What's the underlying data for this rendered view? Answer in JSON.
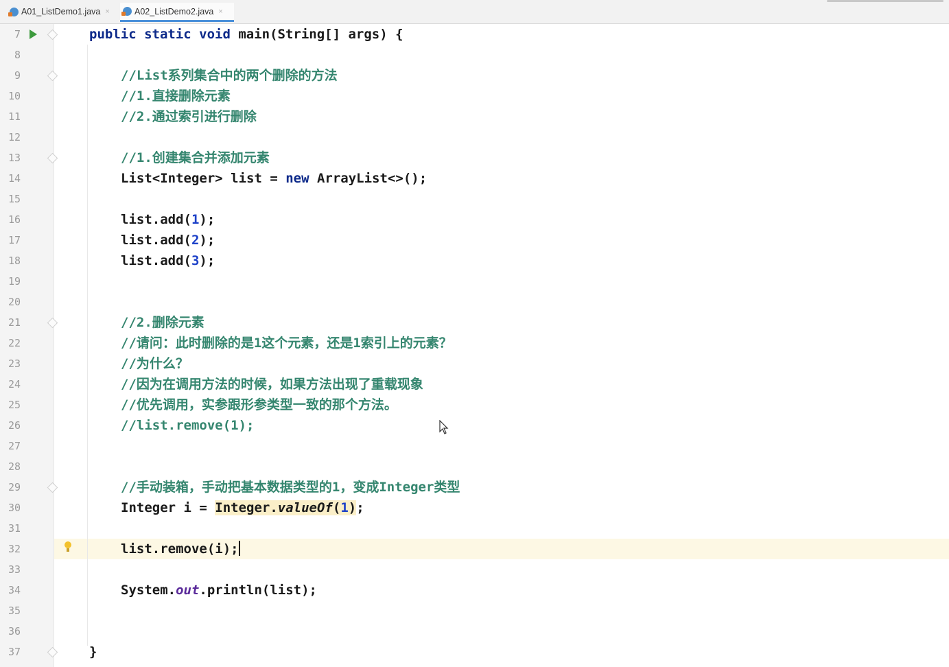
{
  "tabs": [
    {
      "label": "A01_ListDemo1.java",
      "active": false,
      "close_glyph": "×"
    },
    {
      "label": "A02_ListDemo2.java",
      "active": true,
      "close_glyph": "×"
    }
  ],
  "code": {
    "line7": {
      "n": "7",
      "kw1": "public static void",
      "rest": " main(String[] args) {"
    },
    "line8": {
      "n": "8"
    },
    "line9": {
      "n": "9",
      "comment": "//List系列集合中的两个删除的方法"
    },
    "line10": {
      "n": "10",
      "comment": "//1.直接删除元素"
    },
    "line11": {
      "n": "11",
      "comment": "//2.通过索引进行删除"
    },
    "line12": {
      "n": "12"
    },
    "line13": {
      "n": "13",
      "comment": "//1.创建集合并添加元素"
    },
    "line14": {
      "n": "14",
      "pre": "List<Integer> list = ",
      "kw": "new",
      "post": " ArrayList<>();"
    },
    "line15": {
      "n": "15"
    },
    "line16": {
      "n": "16",
      "pre": "list.add(",
      "num": "1",
      "post": ");"
    },
    "line17": {
      "n": "17",
      "pre": "list.add(",
      "num": "2",
      "post": ");"
    },
    "line18": {
      "n": "18",
      "pre": "list.add(",
      "num": "3",
      "post": ");"
    },
    "line19": {
      "n": "19"
    },
    "line20": {
      "n": "20"
    },
    "line21": {
      "n": "21",
      "comment": "//2.删除元素"
    },
    "line22": {
      "n": "22",
      "comment": "//请问：此时删除的是1这个元素，还是1索引上的元素？"
    },
    "line23": {
      "n": "23",
      "comment": "//为什么？"
    },
    "line24": {
      "n": "24",
      "comment": "//因为在调用方法的时候，如果方法出现了重载现象"
    },
    "line25": {
      "n": "25",
      "comment": "//优先调用，实参跟形参类型一致的那个方法。"
    },
    "line26": {
      "n": "26",
      "comment": "//list.remove(1);"
    },
    "line27": {
      "n": "27"
    },
    "line28": {
      "n": "28"
    },
    "line29": {
      "n": "29",
      "comment": "//手动装箱，手动把基本数据类型的1，变成Integer类型"
    },
    "line30": {
      "n": "30",
      "pre": "Integer i = ",
      "hl_a": "Integer.",
      "hl_method": "valueOf",
      "hl_b": "(",
      "num": "1",
      "hl_c": ")",
      "post": ";"
    },
    "line31": {
      "n": "31"
    },
    "line32": {
      "n": "32",
      "text": "list.remove(i);"
    },
    "line33": {
      "n": "33"
    },
    "line34": {
      "n": "34",
      "pre": "System.",
      "field": "out",
      "post": ".println(list);"
    },
    "line35": {
      "n": "35"
    },
    "line36": {
      "n": "36"
    },
    "line37": {
      "n": "37",
      "text": "}"
    }
  },
  "icons": {
    "tab_file": "java-class-icon",
    "run": "run-icon",
    "bulb": "lightbulb-icon",
    "fold": "fold-marker-icon",
    "cursor": "mouse-pointer-icon"
  },
  "colors": {
    "keyword": "#0d2a8a",
    "comment": "#35866f",
    "number": "#1d41c8",
    "current_line": "#fdf8e4",
    "highlight": "#fbefc8",
    "active_tab_underline": "#4a90d9"
  }
}
